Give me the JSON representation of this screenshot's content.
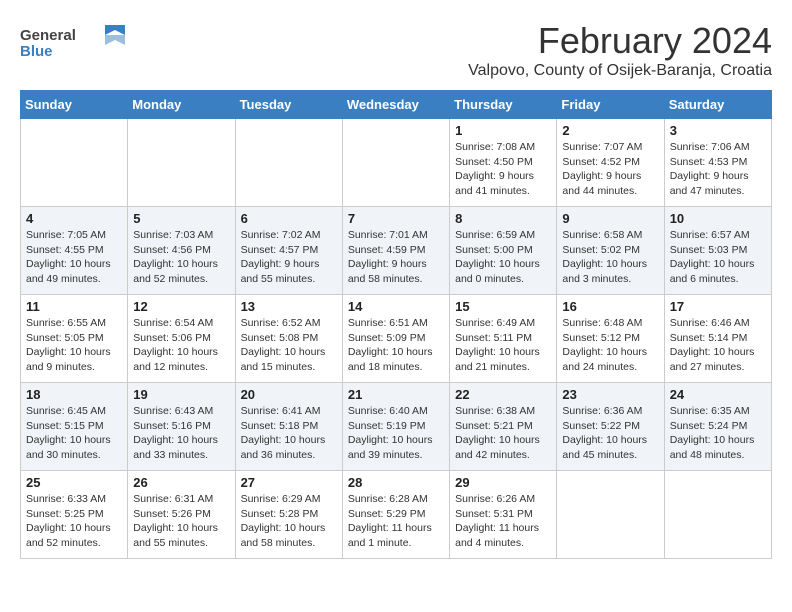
{
  "header": {
    "logo_general": "General",
    "logo_blue": "Blue",
    "month_year": "February 2024",
    "location": "Valpovo, County of Osijek-Baranja, Croatia"
  },
  "calendar": {
    "weekdays": [
      "Sunday",
      "Monday",
      "Tuesday",
      "Wednesday",
      "Thursday",
      "Friday",
      "Saturday"
    ],
    "weeks": [
      [
        {
          "day": "",
          "empty": true
        },
        {
          "day": "",
          "empty": true
        },
        {
          "day": "",
          "empty": true
        },
        {
          "day": "",
          "empty": true
        },
        {
          "day": "1",
          "sunrise": "7:08 AM",
          "sunset": "4:50 PM",
          "daylight": "9 hours and 41 minutes."
        },
        {
          "day": "2",
          "sunrise": "7:07 AM",
          "sunset": "4:52 PM",
          "daylight": "9 hours and 44 minutes."
        },
        {
          "day": "3",
          "sunrise": "7:06 AM",
          "sunset": "4:53 PM",
          "daylight": "9 hours and 47 minutes."
        }
      ],
      [
        {
          "day": "4",
          "sunrise": "7:05 AM",
          "sunset": "4:55 PM",
          "daylight": "10 hours and 49 minutes."
        },
        {
          "day": "5",
          "sunrise": "7:03 AM",
          "sunset": "4:56 PM",
          "daylight": "10 hours and 52 minutes."
        },
        {
          "day": "6",
          "sunrise": "7:02 AM",
          "sunset": "4:57 PM",
          "daylight": "9 hours and 55 minutes."
        },
        {
          "day": "7",
          "sunrise": "7:01 AM",
          "sunset": "4:59 PM",
          "daylight": "9 hours and 58 minutes."
        },
        {
          "day": "8",
          "sunrise": "6:59 AM",
          "sunset": "5:00 PM",
          "daylight": "10 hours and 0 minutes."
        },
        {
          "day": "9",
          "sunrise": "6:58 AM",
          "sunset": "5:02 PM",
          "daylight": "10 hours and 3 minutes."
        },
        {
          "day": "10",
          "sunrise": "6:57 AM",
          "sunset": "5:03 PM",
          "daylight": "10 hours and 6 minutes."
        }
      ],
      [
        {
          "day": "11",
          "sunrise": "6:55 AM",
          "sunset": "5:05 PM",
          "daylight": "10 hours and 9 minutes."
        },
        {
          "day": "12",
          "sunrise": "6:54 AM",
          "sunset": "5:06 PM",
          "daylight": "10 hours and 12 minutes."
        },
        {
          "day": "13",
          "sunrise": "6:52 AM",
          "sunset": "5:08 PM",
          "daylight": "10 hours and 15 minutes."
        },
        {
          "day": "14",
          "sunrise": "6:51 AM",
          "sunset": "5:09 PM",
          "daylight": "10 hours and 18 minutes."
        },
        {
          "day": "15",
          "sunrise": "6:49 AM",
          "sunset": "5:11 PM",
          "daylight": "10 hours and 21 minutes."
        },
        {
          "day": "16",
          "sunrise": "6:48 AM",
          "sunset": "5:12 PM",
          "daylight": "10 hours and 24 minutes."
        },
        {
          "day": "17",
          "sunrise": "6:46 AM",
          "sunset": "5:14 PM",
          "daylight": "10 hours and 27 minutes."
        }
      ],
      [
        {
          "day": "18",
          "sunrise": "6:45 AM",
          "sunset": "5:15 PM",
          "daylight": "10 hours and 30 minutes."
        },
        {
          "day": "19",
          "sunrise": "6:43 AM",
          "sunset": "5:16 PM",
          "daylight": "10 hours and 33 minutes."
        },
        {
          "day": "20",
          "sunrise": "6:41 AM",
          "sunset": "5:18 PM",
          "daylight": "10 hours and 36 minutes."
        },
        {
          "day": "21",
          "sunrise": "6:40 AM",
          "sunset": "5:19 PM",
          "daylight": "10 hours and 39 minutes."
        },
        {
          "day": "22",
          "sunrise": "6:38 AM",
          "sunset": "5:21 PM",
          "daylight": "10 hours and 42 minutes."
        },
        {
          "day": "23",
          "sunrise": "6:36 AM",
          "sunset": "5:22 PM",
          "daylight": "10 hours and 45 minutes."
        },
        {
          "day": "24",
          "sunrise": "6:35 AM",
          "sunset": "5:24 PM",
          "daylight": "10 hours and 48 minutes."
        }
      ],
      [
        {
          "day": "25",
          "sunrise": "6:33 AM",
          "sunset": "5:25 PM",
          "daylight": "10 hours and 52 minutes."
        },
        {
          "day": "26",
          "sunrise": "6:31 AM",
          "sunset": "5:26 PM",
          "daylight": "10 hours and 55 minutes."
        },
        {
          "day": "27",
          "sunrise": "6:29 AM",
          "sunset": "5:28 PM",
          "daylight": "10 hours and 58 minutes."
        },
        {
          "day": "28",
          "sunrise": "6:28 AM",
          "sunset": "5:29 PM",
          "daylight": "11 hours and 1 minute."
        },
        {
          "day": "29",
          "sunrise": "6:26 AM",
          "sunset": "5:31 PM",
          "daylight": "11 hours and 4 minutes."
        },
        {
          "day": "",
          "empty": true
        },
        {
          "day": "",
          "empty": true
        }
      ]
    ]
  }
}
